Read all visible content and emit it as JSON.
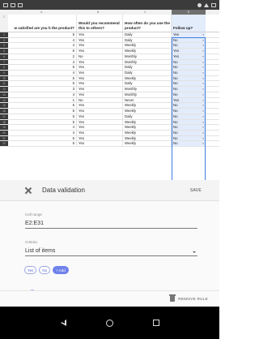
{
  "sheet": {
    "columns": [
      "A",
      "B",
      "C",
      "D",
      "E"
    ],
    "selected_column": "E",
    "headers": {
      "a": "w satisfied are you h the product?",
      "b": "Would you recommend this to others?",
      "c": "How often do you use the product?",
      "d": "Follow up?"
    },
    "rows": [
      {
        "n": "2",
        "a": "5",
        "b": "Yes",
        "c": "Daily",
        "d": "Yes"
      },
      {
        "n": "3",
        "a": "4",
        "b": "Yes",
        "c": "Daily",
        "d": "No"
      },
      {
        "n": "4",
        "a": "4",
        "b": "Yes",
        "c": "Weekly",
        "d": "No"
      },
      {
        "n": "5",
        "a": "5",
        "b": "Yes",
        "c": "Weekly",
        "d": "Yes"
      },
      {
        "n": "6",
        "a": "2",
        "b": "No",
        "c": "Monthly",
        "d": "Yes"
      },
      {
        "n": "7",
        "a": "4",
        "b": "Yes",
        "c": "Monthly",
        "d": "No"
      },
      {
        "n": "8",
        "a": "5",
        "b": "Yes",
        "c": "Daily",
        "d": "No"
      },
      {
        "n": "9",
        "a": "4",
        "b": "Yes",
        "c": "Daily",
        "d": "No"
      },
      {
        "n": "10",
        "a": "5",
        "b": "Yes",
        "c": "Weekly",
        "d": "No"
      },
      {
        "n": "11",
        "a": "5",
        "b": "Yes",
        "c": "Daily",
        "d": "No"
      },
      {
        "n": "12",
        "a": "3",
        "b": "Yes",
        "c": "Monthly",
        "d": "No"
      },
      {
        "n": "13",
        "a": "4",
        "b": "Yes",
        "c": "Monthly",
        "d": "No"
      },
      {
        "n": "14",
        "a": "1",
        "b": "No",
        "c": "Never",
        "d": "Yes"
      },
      {
        "n": "15",
        "a": "5",
        "b": "Yes",
        "c": "Weekly",
        "d": "No"
      },
      {
        "n": "16",
        "a": "5",
        "b": "Yes",
        "c": "Weekly",
        "d": "No"
      },
      {
        "n": "17",
        "a": "5",
        "b": "Yes",
        "c": "Daily",
        "d": "No"
      },
      {
        "n": "18",
        "a": "5",
        "b": "Yes",
        "c": "Weekly",
        "d": "No"
      },
      {
        "n": "19",
        "a": "4",
        "b": "Yes",
        "c": "Weekly",
        "d": "No"
      },
      {
        "n": "20",
        "a": "4",
        "b": "Yes",
        "c": "Weekly",
        "d": "No"
      },
      {
        "n": "21",
        "a": "5",
        "b": "Yes",
        "c": "Weekly",
        "d": "No"
      },
      {
        "n": "22",
        "a": "5",
        "b": "Yes",
        "c": "Weekly",
        "d": "No"
      }
    ]
  },
  "panel": {
    "title": "Data validation",
    "save_label": "SAVE",
    "cell_range_label": "Cell range",
    "cell_range_value": "E2:E31",
    "criteria_label": "Criteria",
    "criteria_value": "List of items",
    "chips": [
      "Yes",
      "No"
    ],
    "add_chip_label": "+ Add",
    "remove_label": "REMOVE RULE"
  },
  "colors": {
    "accent": "#4a63de",
    "selection": "#3d7be0",
    "selection_fill": "#e3ecfb"
  }
}
